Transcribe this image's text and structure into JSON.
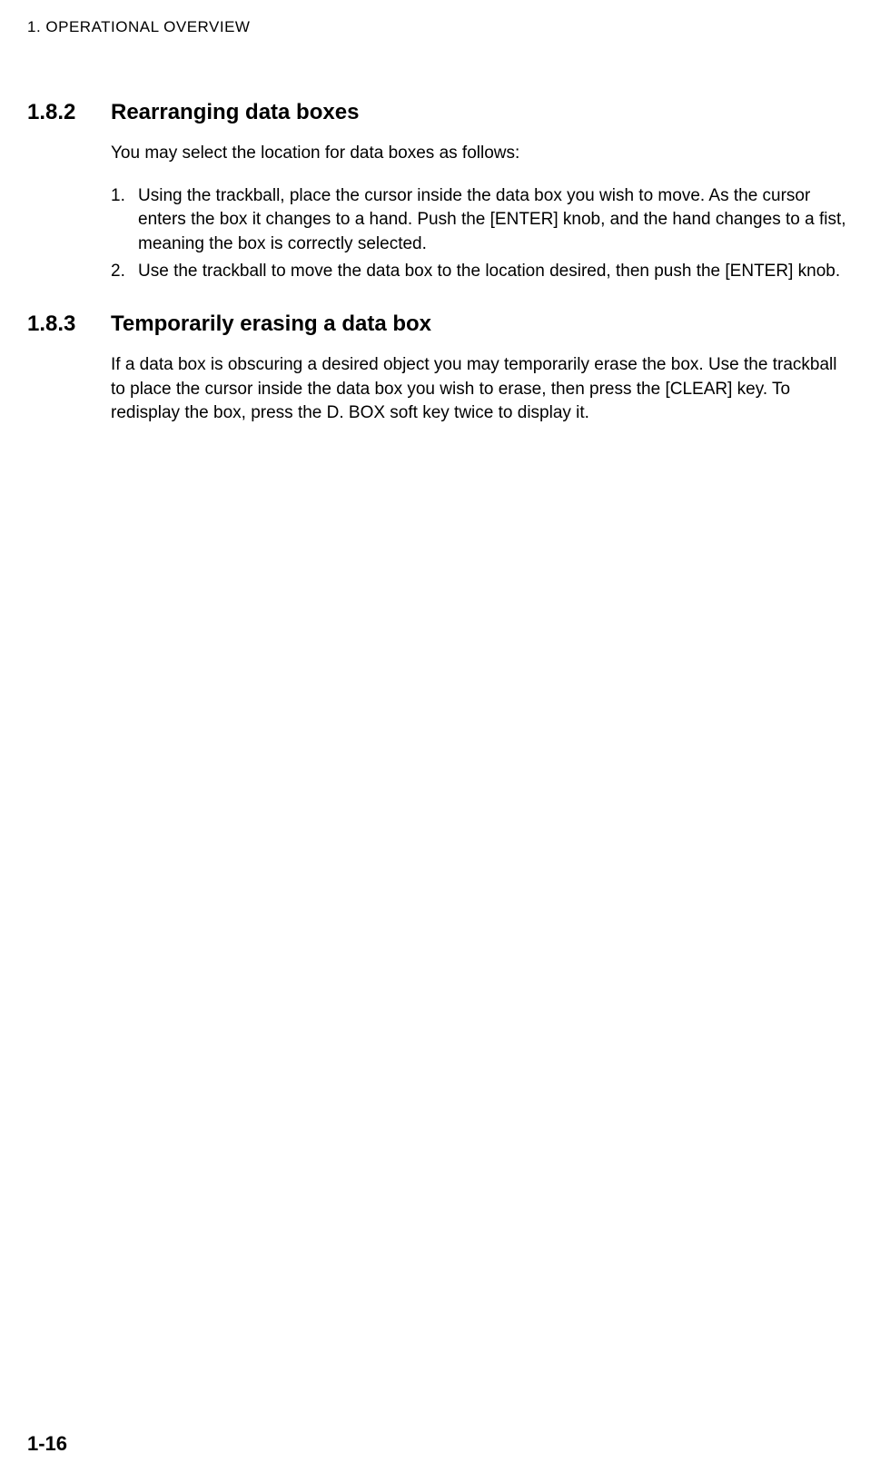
{
  "header": "1. OPERATIONAL OVERVIEW",
  "sections": [
    {
      "number": "1.8.2",
      "title": "Rearranging data boxes",
      "intro": "You may select the location for data boxes as follows:",
      "list": [
        "Using the trackball, place the cursor inside the data box you wish to move. As the cursor enters the box it changes to a hand. Push the [ENTER] knob, and the hand changes to a fist, meaning the box is correctly selected.",
        "Use the trackball to move the data box to the location desired, then push the [ENTER] knob."
      ]
    },
    {
      "number": "1.8.3",
      "title": "Temporarily erasing a data box",
      "body": "If a data box is obscuring a desired object you may temporarily erase the box. Use the trackball to place the cursor inside the data box you wish to erase, then press the [CLEAR] key. To redisplay the box, press the D. BOX soft key twice to display it."
    }
  ],
  "pageNumber": "1-16"
}
